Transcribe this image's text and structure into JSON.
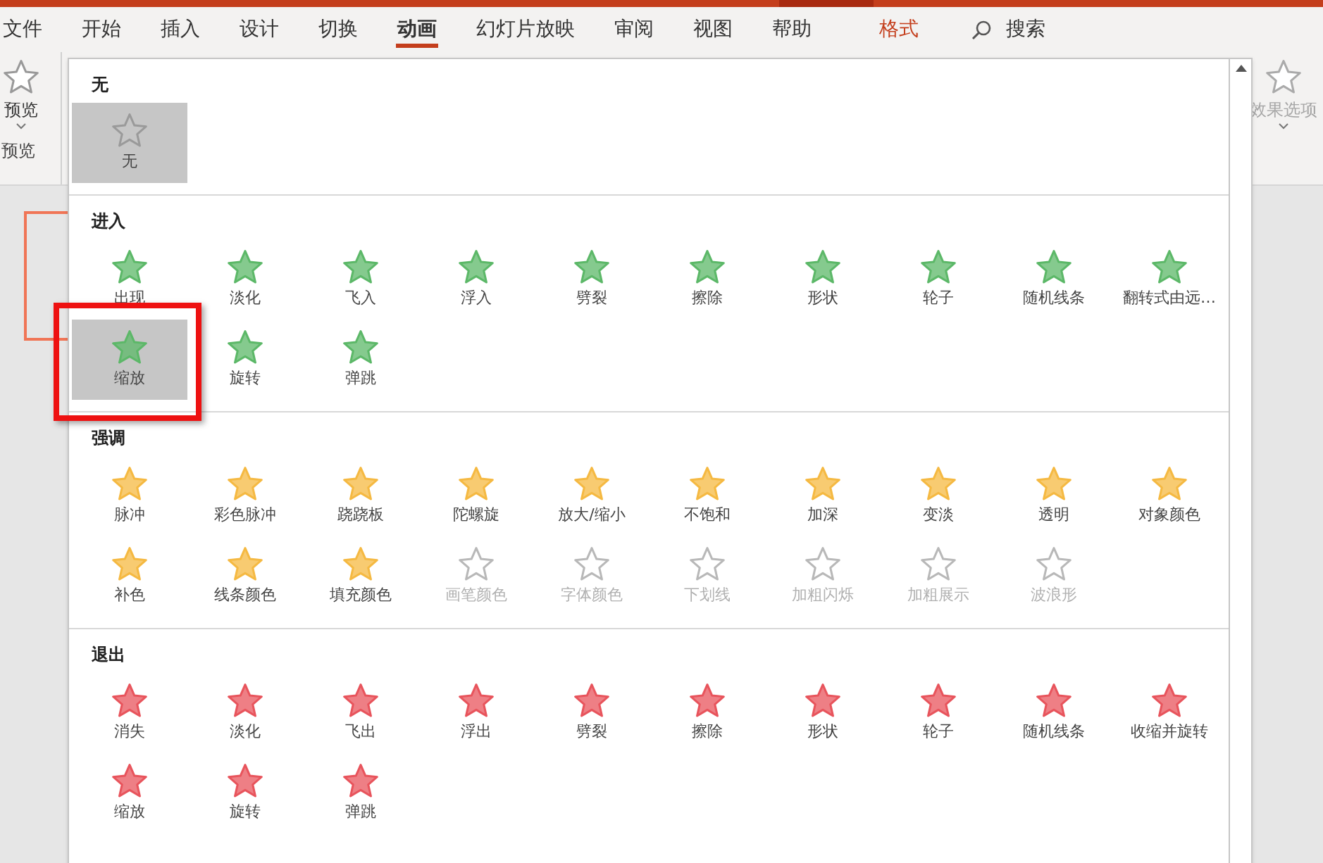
{
  "tabs": [
    {
      "label": "文件",
      "selected": false,
      "kind": "normal"
    },
    {
      "label": "开始",
      "selected": false,
      "kind": "normal"
    },
    {
      "label": "插入",
      "selected": false,
      "kind": "normal"
    },
    {
      "label": "设计",
      "selected": false,
      "kind": "normal"
    },
    {
      "label": "切换",
      "selected": false,
      "kind": "normal"
    },
    {
      "label": "动画",
      "selected": true,
      "kind": "normal"
    },
    {
      "label": "幻灯片放映",
      "selected": false,
      "kind": "normal"
    },
    {
      "label": "审阅",
      "selected": false,
      "kind": "normal"
    },
    {
      "label": "视图",
      "selected": false,
      "kind": "normal"
    },
    {
      "label": "帮助",
      "selected": false,
      "kind": "normal"
    },
    {
      "label": "格式",
      "selected": false,
      "kind": "contextual"
    }
  ],
  "search": {
    "label": "搜索"
  },
  "preview_group": {
    "button": "预览",
    "group_label": "预览"
  },
  "effect_options": {
    "label": "效果选项",
    "disabled": true
  },
  "gallery": {
    "sections": [
      {
        "title": "无",
        "color": "#9a9a9a",
        "items": [
          {
            "label": "无",
            "selected": true,
            "disabled": false
          }
        ]
      },
      {
        "title": "进入",
        "color": "#5cb868",
        "items": [
          {
            "label": "出现",
            "selected": false,
            "disabled": false
          },
          {
            "label": "淡化",
            "selected": false,
            "disabled": false
          },
          {
            "label": "飞入",
            "selected": false,
            "disabled": false
          },
          {
            "label": "浮入",
            "selected": false,
            "disabled": false
          },
          {
            "label": "劈裂",
            "selected": false,
            "disabled": false
          },
          {
            "label": "擦除",
            "selected": false,
            "disabled": false
          },
          {
            "label": "形状",
            "selected": false,
            "disabled": false
          },
          {
            "label": "轮子",
            "selected": false,
            "disabled": false
          },
          {
            "label": "随机线条",
            "selected": false,
            "disabled": false
          },
          {
            "label": "翻转式由远…",
            "selected": false,
            "disabled": false
          },
          {
            "label": "缩放",
            "selected": true,
            "disabled": false
          },
          {
            "label": "旋转",
            "selected": false,
            "disabled": false
          },
          {
            "label": "弹跳",
            "selected": false,
            "disabled": false
          }
        ]
      },
      {
        "title": "强调",
        "color": "#f5b942",
        "items": [
          {
            "label": "脉冲",
            "selected": false,
            "disabled": false
          },
          {
            "label": "彩色脉冲",
            "selected": false,
            "disabled": false
          },
          {
            "label": "跷跷板",
            "selected": false,
            "disabled": false
          },
          {
            "label": "陀螺旋",
            "selected": false,
            "disabled": false
          },
          {
            "label": "放大/缩小",
            "selected": false,
            "disabled": false
          },
          {
            "label": "不饱和",
            "selected": false,
            "disabled": false
          },
          {
            "label": "加深",
            "selected": false,
            "disabled": false
          },
          {
            "label": "变淡",
            "selected": false,
            "disabled": false
          },
          {
            "label": "透明",
            "selected": false,
            "disabled": false
          },
          {
            "label": "对象颜色",
            "selected": false,
            "disabled": false
          },
          {
            "label": "补色",
            "selected": false,
            "disabled": false
          },
          {
            "label": "线条颜色",
            "selected": false,
            "disabled": false
          },
          {
            "label": "填充颜色",
            "selected": false,
            "disabled": false
          },
          {
            "label": "画笔颜色",
            "selected": false,
            "disabled": true
          },
          {
            "label": "字体颜色",
            "selected": false,
            "disabled": true
          },
          {
            "label": "下划线",
            "selected": false,
            "disabled": true
          },
          {
            "label": "加粗闪烁",
            "selected": false,
            "disabled": true
          },
          {
            "label": "加粗展示",
            "selected": false,
            "disabled": true
          },
          {
            "label": "波浪形",
            "selected": false,
            "disabled": true
          }
        ]
      },
      {
        "title": "退出",
        "color": "#e8545c",
        "items": [
          {
            "label": "消失",
            "selected": false,
            "disabled": false
          },
          {
            "label": "淡化",
            "selected": false,
            "disabled": false
          },
          {
            "label": "飞出",
            "selected": false,
            "disabled": false
          },
          {
            "label": "浮出",
            "selected": false,
            "disabled": false
          },
          {
            "label": "劈裂",
            "selected": false,
            "disabled": false
          },
          {
            "label": "擦除",
            "selected": false,
            "disabled": false
          },
          {
            "label": "形状",
            "selected": false,
            "disabled": false
          },
          {
            "label": "轮子",
            "selected": false,
            "disabled": false
          },
          {
            "label": "随机线条",
            "selected": false,
            "disabled": false
          },
          {
            "label": "收缩并旋转",
            "selected": false,
            "disabled": false
          },
          {
            "label": "缩放",
            "selected": false,
            "disabled": false
          },
          {
            "label": "旋转",
            "selected": false,
            "disabled": false
          },
          {
            "label": "弹跳",
            "selected": false,
            "disabled": false
          }
        ]
      }
    ]
  }
}
